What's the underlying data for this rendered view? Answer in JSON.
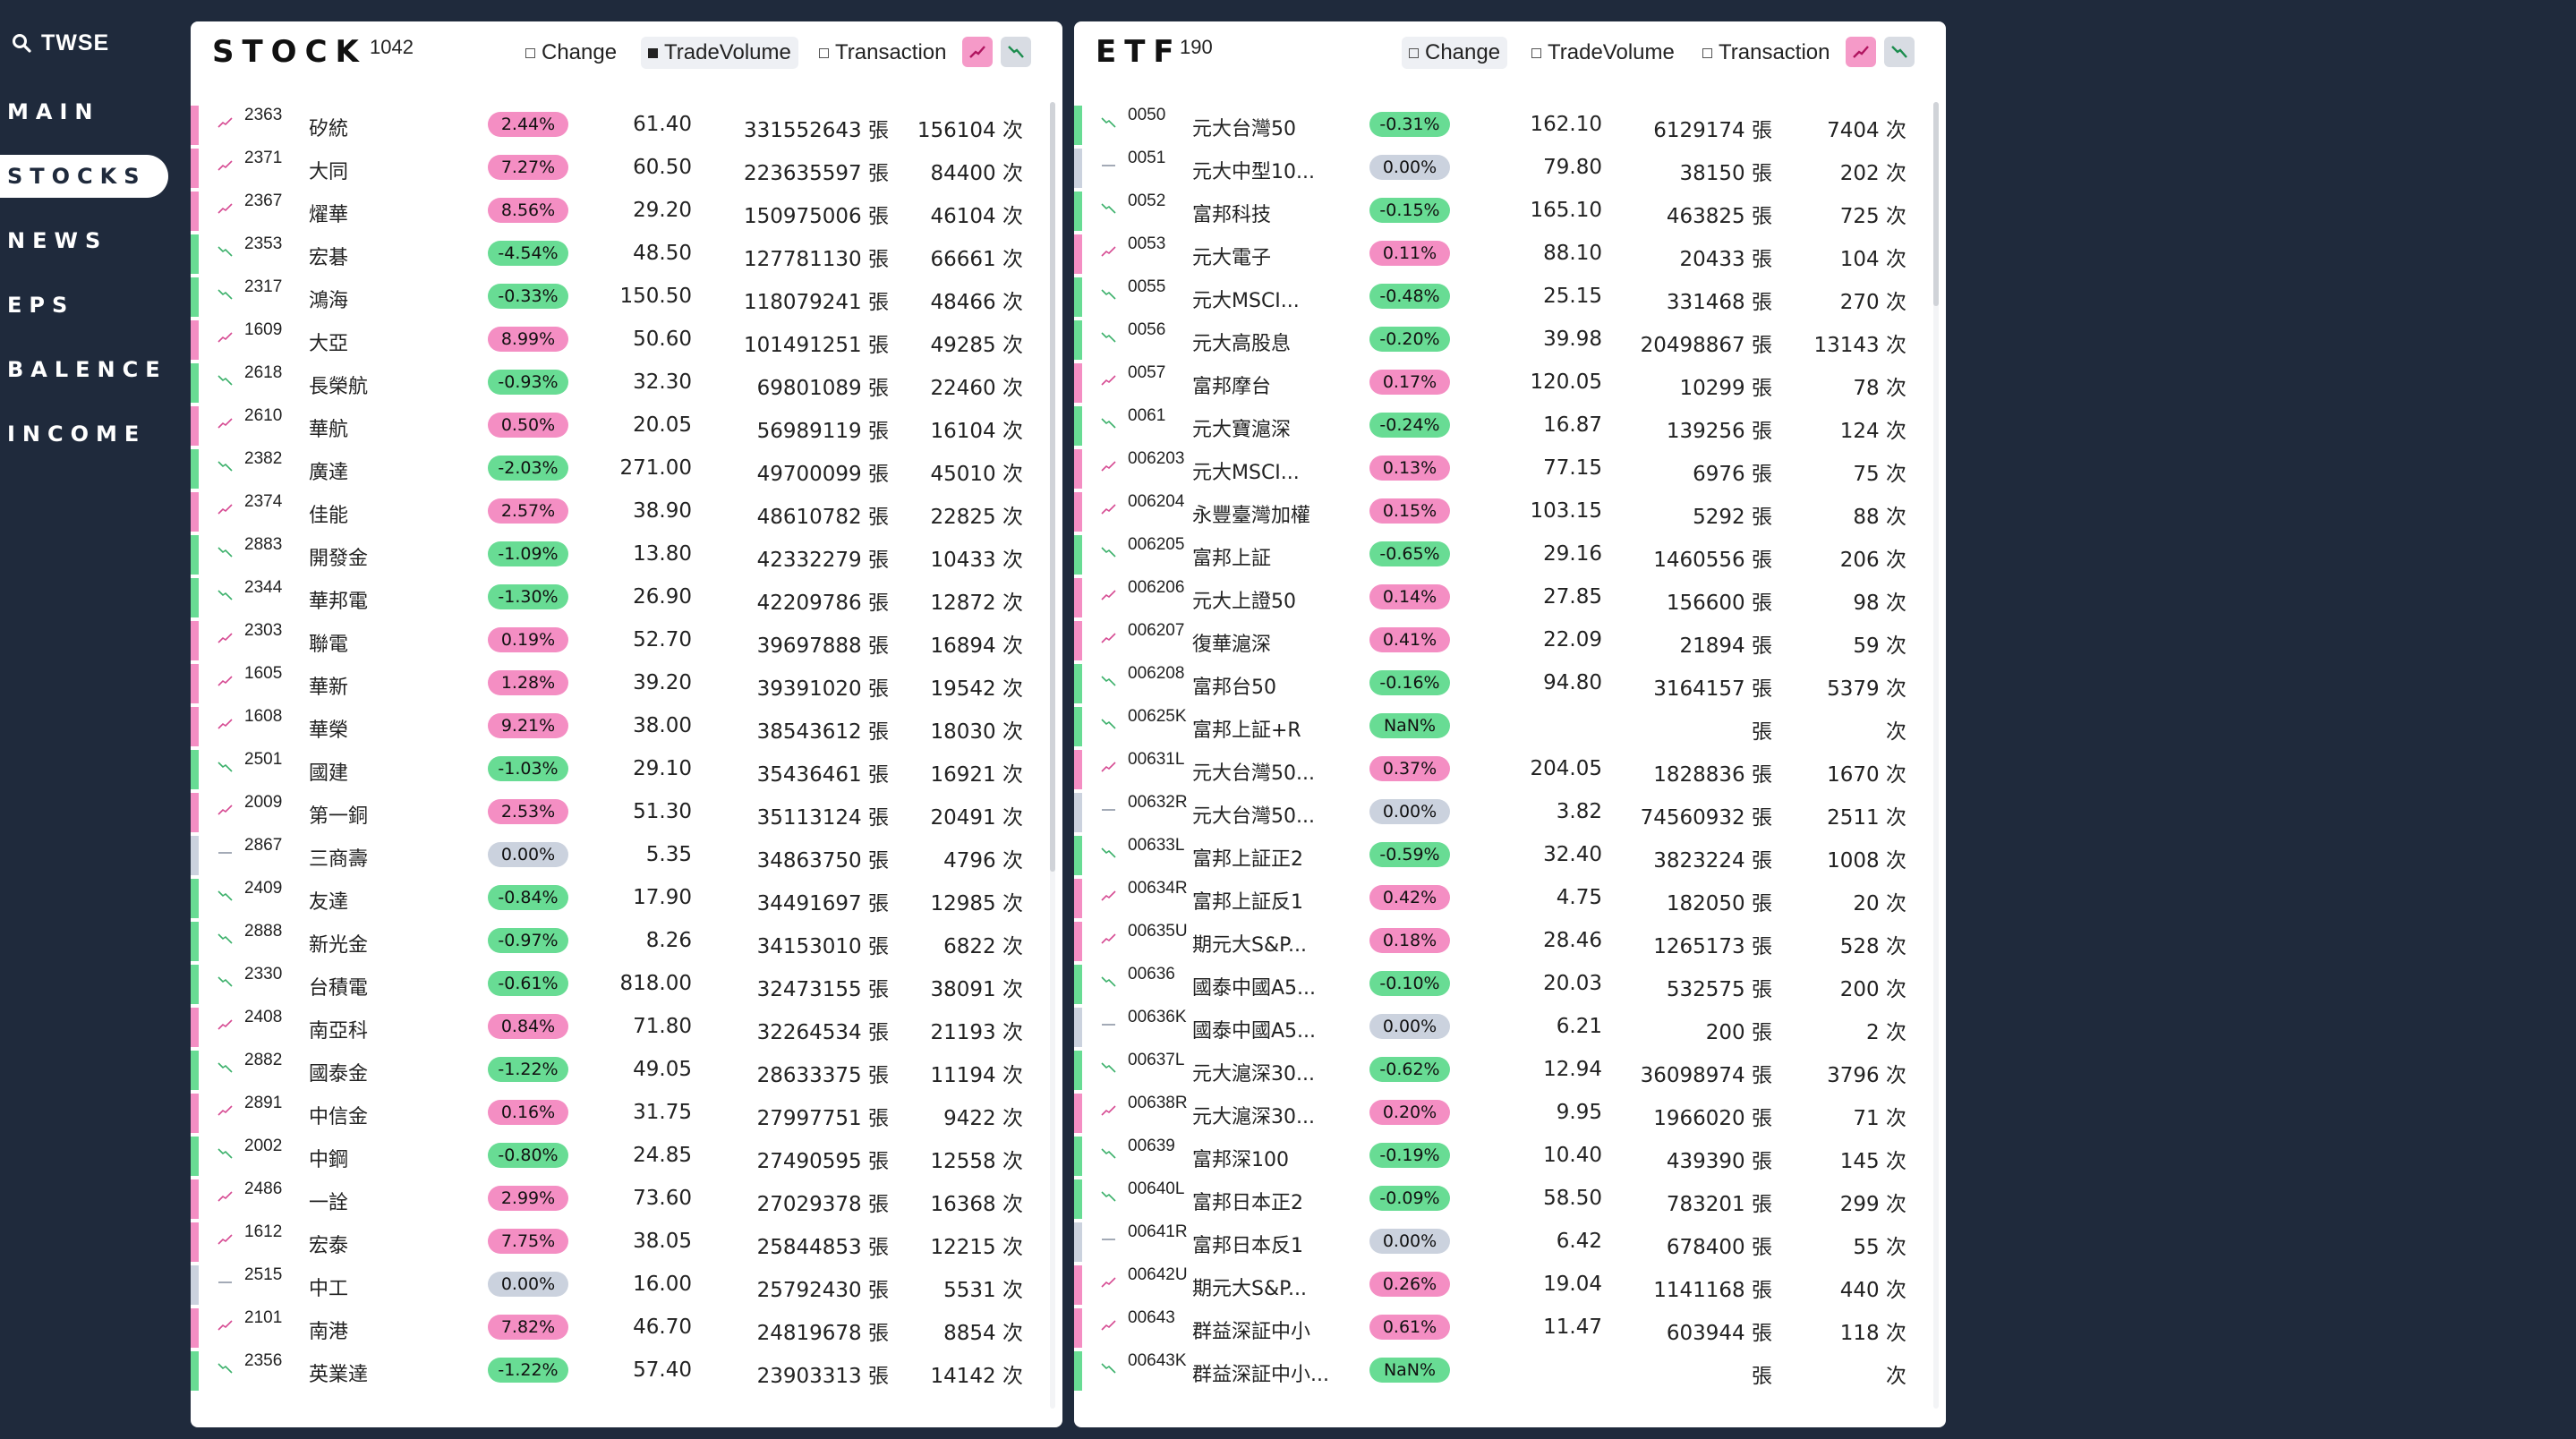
{
  "app": {
    "title": "TWSE"
  },
  "nav": [
    "MAIN",
    "STOCKS",
    "NEWS",
    "EPS",
    "BALENCE",
    "INCOME"
  ],
  "nav_active": "STOCKS",
  "colors": {
    "up": "#f48ec3",
    "down": "#68dc94",
    "flat": "#cbd2de",
    "background": "#1f2a3c"
  },
  "stock": {
    "title": "STOCK",
    "count": "1042",
    "sort": {
      "change": "Change",
      "volume": "TradeVolume",
      "transaction": "Transaction",
      "active": "TradeVolume"
    },
    "rows": [
      {
        "code": "2363",
        "name": "矽統",
        "change": "2.44%",
        "dir": "up",
        "price": "61.40",
        "volume": "331552643 張",
        "tx": "156104 次"
      },
      {
        "code": "2371",
        "name": "大同",
        "change": "7.27%",
        "dir": "up",
        "price": "60.50",
        "volume": "223635597 張",
        "tx": "84400 次"
      },
      {
        "code": "2367",
        "name": "燿華",
        "change": "8.56%",
        "dir": "up",
        "price": "29.20",
        "volume": "150975006 張",
        "tx": "46104 次"
      },
      {
        "code": "2353",
        "name": "宏碁",
        "change": "-4.54%",
        "dir": "down",
        "price": "48.50",
        "volume": "127781130 張",
        "tx": "66661 次"
      },
      {
        "code": "2317",
        "name": "鴻海",
        "change": "-0.33%",
        "dir": "down",
        "price": "150.50",
        "volume": "118079241 張",
        "tx": "48466 次"
      },
      {
        "code": "1609",
        "name": "大亞",
        "change": "8.99%",
        "dir": "up",
        "price": "50.60",
        "volume": "101491251 張",
        "tx": "49285 次"
      },
      {
        "code": "2618",
        "name": "長榮航",
        "change": "-0.93%",
        "dir": "down",
        "price": "32.30",
        "volume": "69801089 張",
        "tx": "22460 次"
      },
      {
        "code": "2610",
        "name": "華航",
        "change": "0.50%",
        "dir": "up",
        "price": "20.05",
        "volume": "56989119 張",
        "tx": "16104 次"
      },
      {
        "code": "2382",
        "name": "廣達",
        "change": "-2.03%",
        "dir": "down",
        "price": "271.00",
        "volume": "49700099 張",
        "tx": "45010 次"
      },
      {
        "code": "2374",
        "name": "佳能",
        "change": "2.57%",
        "dir": "up",
        "price": "38.90",
        "volume": "48610782 張",
        "tx": "22825 次"
      },
      {
        "code": "2883",
        "name": "開發金",
        "change": "-1.09%",
        "dir": "down",
        "price": "13.80",
        "volume": "42332279 張",
        "tx": "10433 次"
      },
      {
        "code": "2344",
        "name": "華邦電",
        "change": "-1.30%",
        "dir": "down",
        "price": "26.90",
        "volume": "42209786 張",
        "tx": "12872 次"
      },
      {
        "code": "2303",
        "name": "聯電",
        "change": "0.19%",
        "dir": "up",
        "price": "52.70",
        "volume": "39697888 張",
        "tx": "16894 次"
      },
      {
        "code": "1605",
        "name": "華新",
        "change": "1.28%",
        "dir": "up",
        "price": "39.20",
        "volume": "39391020 張",
        "tx": "19542 次"
      },
      {
        "code": "1608",
        "name": "華榮",
        "change": "9.21%",
        "dir": "up",
        "price": "38.00",
        "volume": "38543612 張",
        "tx": "18030 次"
      },
      {
        "code": "2501",
        "name": "國建",
        "change": "-1.03%",
        "dir": "down",
        "price": "29.10",
        "volume": "35436461 張",
        "tx": "16921 次"
      },
      {
        "code": "2009",
        "name": "第一銅",
        "change": "2.53%",
        "dir": "up",
        "price": "51.30",
        "volume": "35113124 張",
        "tx": "20491 次"
      },
      {
        "code": "2867",
        "name": "三商壽",
        "change": "0.00%",
        "dir": "flat",
        "price": "5.35",
        "volume": "34863750 張",
        "tx": "4796 次"
      },
      {
        "code": "2409",
        "name": "友達",
        "change": "-0.84%",
        "dir": "down",
        "price": "17.90",
        "volume": "34491697 張",
        "tx": "12985 次"
      },
      {
        "code": "2888",
        "name": "新光金",
        "change": "-0.97%",
        "dir": "down",
        "price": "8.26",
        "volume": "34153010 張",
        "tx": "6822 次"
      },
      {
        "code": "2330",
        "name": "台積電",
        "change": "-0.61%",
        "dir": "down",
        "price": "818.00",
        "volume": "32473155 張",
        "tx": "38091 次"
      },
      {
        "code": "2408",
        "name": "南亞科",
        "change": "0.84%",
        "dir": "up",
        "price": "71.80",
        "volume": "32264534 張",
        "tx": "21193 次"
      },
      {
        "code": "2882",
        "name": "國泰金",
        "change": "-1.22%",
        "dir": "down",
        "price": "49.05",
        "volume": "28633375 張",
        "tx": "11194 次"
      },
      {
        "code": "2891",
        "name": "中信金",
        "change": "0.16%",
        "dir": "up",
        "price": "31.75",
        "volume": "27997751 張",
        "tx": "9422 次"
      },
      {
        "code": "2002",
        "name": "中鋼",
        "change": "-0.80%",
        "dir": "down",
        "price": "24.85",
        "volume": "27490595 張",
        "tx": "12558 次"
      },
      {
        "code": "2486",
        "name": "一詮",
        "change": "2.99%",
        "dir": "up",
        "price": "73.60",
        "volume": "27029378 張",
        "tx": "16368 次"
      },
      {
        "code": "1612",
        "name": "宏泰",
        "change": "7.75%",
        "dir": "up",
        "price": "38.05",
        "volume": "25844853 張",
        "tx": "12215 次"
      },
      {
        "code": "2515",
        "name": "中工",
        "change": "0.00%",
        "dir": "flat",
        "price": "16.00",
        "volume": "25792430 張",
        "tx": "5531 次"
      },
      {
        "code": "2101",
        "name": "南港",
        "change": "7.82%",
        "dir": "up",
        "price": "46.70",
        "volume": "24819678 張",
        "tx": "8854 次"
      },
      {
        "code": "2356",
        "name": "英業達",
        "change": "-1.22%",
        "dir": "down",
        "price": "57.40",
        "volume": "23903313 張",
        "tx": "14142 次"
      }
    ]
  },
  "etf": {
    "title": "ETF",
    "count": "190",
    "sort": {
      "change": "Change",
      "volume": "TradeVolume",
      "transaction": "Transaction",
      "active": "Change"
    },
    "rows": [
      {
        "code": "0050",
        "name": "元大台灣50",
        "change": "-0.31%",
        "dir": "down",
        "price": "162.10",
        "volume": "6129174 張",
        "tx": "7404 次"
      },
      {
        "code": "0051",
        "name": "元大中型10...",
        "change": "0.00%",
        "dir": "flat",
        "price": "79.80",
        "volume": "38150 張",
        "tx": "202 次"
      },
      {
        "code": "0052",
        "name": "富邦科技",
        "change": "-0.15%",
        "dir": "down",
        "price": "165.10",
        "volume": "463825 張",
        "tx": "725 次"
      },
      {
        "code": "0053",
        "name": "元大電子",
        "change": "0.11%",
        "dir": "up",
        "price": "88.10",
        "volume": "20433 張",
        "tx": "104 次"
      },
      {
        "code": "0055",
        "name": "元大MSCI...",
        "change": "-0.48%",
        "dir": "down",
        "price": "25.15",
        "volume": "331468 張",
        "tx": "270 次"
      },
      {
        "code": "0056",
        "name": "元大高股息",
        "change": "-0.20%",
        "dir": "down",
        "price": "39.98",
        "volume": "20498867 張",
        "tx": "13143 次"
      },
      {
        "code": "0057",
        "name": "富邦摩台",
        "change": "0.17%",
        "dir": "up",
        "price": "120.05",
        "volume": "10299 張",
        "tx": "78 次"
      },
      {
        "code": "0061",
        "name": "元大寶滬深",
        "change": "-0.24%",
        "dir": "down",
        "price": "16.87",
        "volume": "139256 張",
        "tx": "124 次"
      },
      {
        "code": "006203",
        "name": "元大MSCI...",
        "change": "0.13%",
        "dir": "up",
        "price": "77.15",
        "volume": "6976 張",
        "tx": "75 次"
      },
      {
        "code": "006204",
        "name": "永豐臺灣加權",
        "change": "0.15%",
        "dir": "up",
        "price": "103.15",
        "volume": "5292 張",
        "tx": "88 次"
      },
      {
        "code": "006205",
        "name": "富邦上証",
        "change": "-0.65%",
        "dir": "down",
        "price": "29.16",
        "volume": "1460556 張",
        "tx": "206 次"
      },
      {
        "code": "006206",
        "name": "元大上證50",
        "change": "0.14%",
        "dir": "up",
        "price": "27.85",
        "volume": "156600 張",
        "tx": "98 次"
      },
      {
        "code": "006207",
        "name": "復華滬深",
        "change": "0.41%",
        "dir": "up",
        "price": "22.09",
        "volume": "21894 張",
        "tx": "59 次"
      },
      {
        "code": "006208",
        "name": "富邦台50",
        "change": "-0.16%",
        "dir": "down",
        "price": "94.80",
        "volume": "3164157 張",
        "tx": "5379 次"
      },
      {
        "code": "00625K",
        "name": "富邦上証+R",
        "change": "NaN%",
        "dir": "down",
        "price": "",
        "volume": "張",
        "tx": "次"
      },
      {
        "code": "00631L",
        "name": "元大台灣50...",
        "change": "0.37%",
        "dir": "up",
        "price": "204.05",
        "volume": "1828836 張",
        "tx": "1670 次"
      },
      {
        "code": "00632R",
        "name": "元大台灣50...",
        "change": "0.00%",
        "dir": "flat",
        "price": "3.82",
        "volume": "74560932 張",
        "tx": "2511 次"
      },
      {
        "code": "00633L",
        "name": "富邦上証正2",
        "change": "-0.59%",
        "dir": "down",
        "price": "32.40",
        "volume": "3823224 張",
        "tx": "1008 次"
      },
      {
        "code": "00634R",
        "name": "富邦上証反1",
        "change": "0.42%",
        "dir": "up",
        "price": "4.75",
        "volume": "182050 張",
        "tx": "20 次"
      },
      {
        "code": "00635U",
        "name": "期元大S&P...",
        "change": "0.18%",
        "dir": "up",
        "price": "28.46",
        "volume": "1265173 張",
        "tx": "528 次"
      },
      {
        "code": "00636",
        "name": "國泰中國A5...",
        "change": "-0.10%",
        "dir": "down",
        "price": "20.03",
        "volume": "532575 張",
        "tx": "200 次"
      },
      {
        "code": "00636K",
        "name": "國泰中國A5...",
        "change": "0.00%",
        "dir": "flat",
        "price": "6.21",
        "volume": "200 張",
        "tx": "2 次"
      },
      {
        "code": "00637L",
        "name": "元大滬深30...",
        "change": "-0.62%",
        "dir": "down",
        "price": "12.94",
        "volume": "36098974 張",
        "tx": "3796 次"
      },
      {
        "code": "00638R",
        "name": "元大滬深30...",
        "change": "0.20%",
        "dir": "up",
        "price": "9.95",
        "volume": "1966020 張",
        "tx": "71 次"
      },
      {
        "code": "00639",
        "name": "富邦深100",
        "change": "-0.19%",
        "dir": "down",
        "price": "10.40",
        "volume": "439390 張",
        "tx": "145 次"
      },
      {
        "code": "00640L",
        "name": "富邦日本正2",
        "change": "-0.09%",
        "dir": "down",
        "price": "58.50",
        "volume": "783201 張",
        "tx": "299 次"
      },
      {
        "code": "00641R",
        "name": "富邦日本反1",
        "change": "0.00%",
        "dir": "flat",
        "price": "6.42",
        "volume": "678400 張",
        "tx": "55 次"
      },
      {
        "code": "00642U",
        "name": "期元大S&P...",
        "change": "0.26%",
        "dir": "up",
        "price": "19.04",
        "volume": "1141168 張",
        "tx": "440 次"
      },
      {
        "code": "00643",
        "name": "群益深証中小",
        "change": "0.61%",
        "dir": "up",
        "price": "11.47",
        "volume": "603944 張",
        "tx": "118 次"
      },
      {
        "code": "00643K",
        "name": "群益深証中小...",
        "change": "NaN%",
        "dir": "down",
        "price": "",
        "volume": "張",
        "tx": "次"
      }
    ]
  }
}
